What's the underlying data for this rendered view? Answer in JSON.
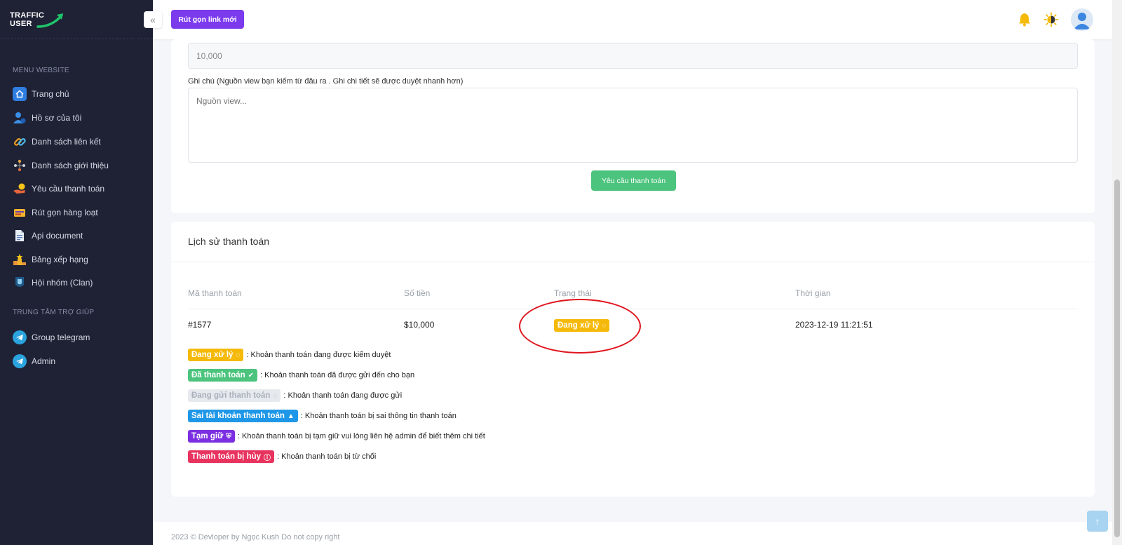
{
  "brand": {
    "line1": "TRAFFIC",
    "line2": "USER"
  },
  "header": {
    "shorten_button": "Rút gọn link mới"
  },
  "sidebar": {
    "section_menu": "MENU WEBSITE",
    "items": [
      {
        "label": "Trang chủ",
        "icon": "home-icon"
      },
      {
        "label": "Hồ sơ của tôi",
        "icon": "user-profile-icon"
      },
      {
        "label": "Danh sách liên kết",
        "icon": "link-icon"
      },
      {
        "label": "Danh sách giới thiệu",
        "icon": "referral-icon"
      },
      {
        "label": "Yêu cầu thanh toán",
        "icon": "payment-icon"
      },
      {
        "label": "Rút gọn hàng loạt",
        "icon": "bulk-shorten-icon"
      },
      {
        "label": "Api document",
        "icon": "document-icon"
      },
      {
        "label": "Bảng xếp hạng",
        "icon": "ranking-icon"
      },
      {
        "label": "Hội nhóm (Clan)",
        "icon": "clan-icon"
      }
    ],
    "section_help": "TRUNG TÂM TRỢ GIÚP",
    "help_items": [
      {
        "label": "Group telegram",
        "icon": "telegram-icon"
      },
      {
        "label": "Admin",
        "icon": "telegram-icon"
      }
    ]
  },
  "form": {
    "amount_value": "10,000",
    "note_label": "Ghi chú (Nguồn view bạn kiếm từ đâu ra . Ghi chi tiết sẽ được duyệt nhanh hơn)",
    "note_placeholder": "Nguồn view...",
    "submit_label": "Yêu cầu thanh toán"
  },
  "history": {
    "title": "Lịch sử thanh toán",
    "columns": [
      "Mã thanh toán",
      "Số tiền",
      "Trạng thái",
      "Thời gian"
    ],
    "rows": [
      {
        "id": "#1577",
        "amount": "$10,000",
        "status": "Đang xử lý",
        "time": "2023-12-19 11:21:51"
      }
    ]
  },
  "legend": [
    {
      "badge": "Đang xử lý",
      "color": "#f5b90a",
      "icon": "spinner-icon",
      "desc": ": Khoản thanh toán đang được kiểm duyệt"
    },
    {
      "badge": "Đã thanh toán",
      "color": "#4cc47e",
      "icon": "check-circle-icon",
      "desc": ": Khoản thanh toán đã được gửi đến cho bạn"
    },
    {
      "badge": "Đang gửi thanh toán",
      "color": "#e6e9ee",
      "icon": "spinner-icon",
      "desc": ": Khoản thanh toán đang được gửi"
    },
    {
      "badge": "Sai tài khoản thanh toán",
      "color": "#1f97e8",
      "icon": "warning-icon",
      "desc": ": Khoản thanh toán bị sai thông tin thanh toán"
    },
    {
      "badge": "Tạm giữ",
      "color": "#7b2fe0",
      "icon": "shield-icon",
      "desc": ": Khoản thanh toán bị tạm giữ vui lòng liên hệ admin để biết thêm chi tiết"
    },
    {
      "badge": "Thanh toán bị hủy",
      "color": "#e8335e",
      "icon": "info-circle-icon",
      "desc": ": Khoản thanh toán bị từ chối"
    }
  ],
  "footer": {
    "text": "2023 © Devloper by Ngọc Kush Do not copy right"
  }
}
